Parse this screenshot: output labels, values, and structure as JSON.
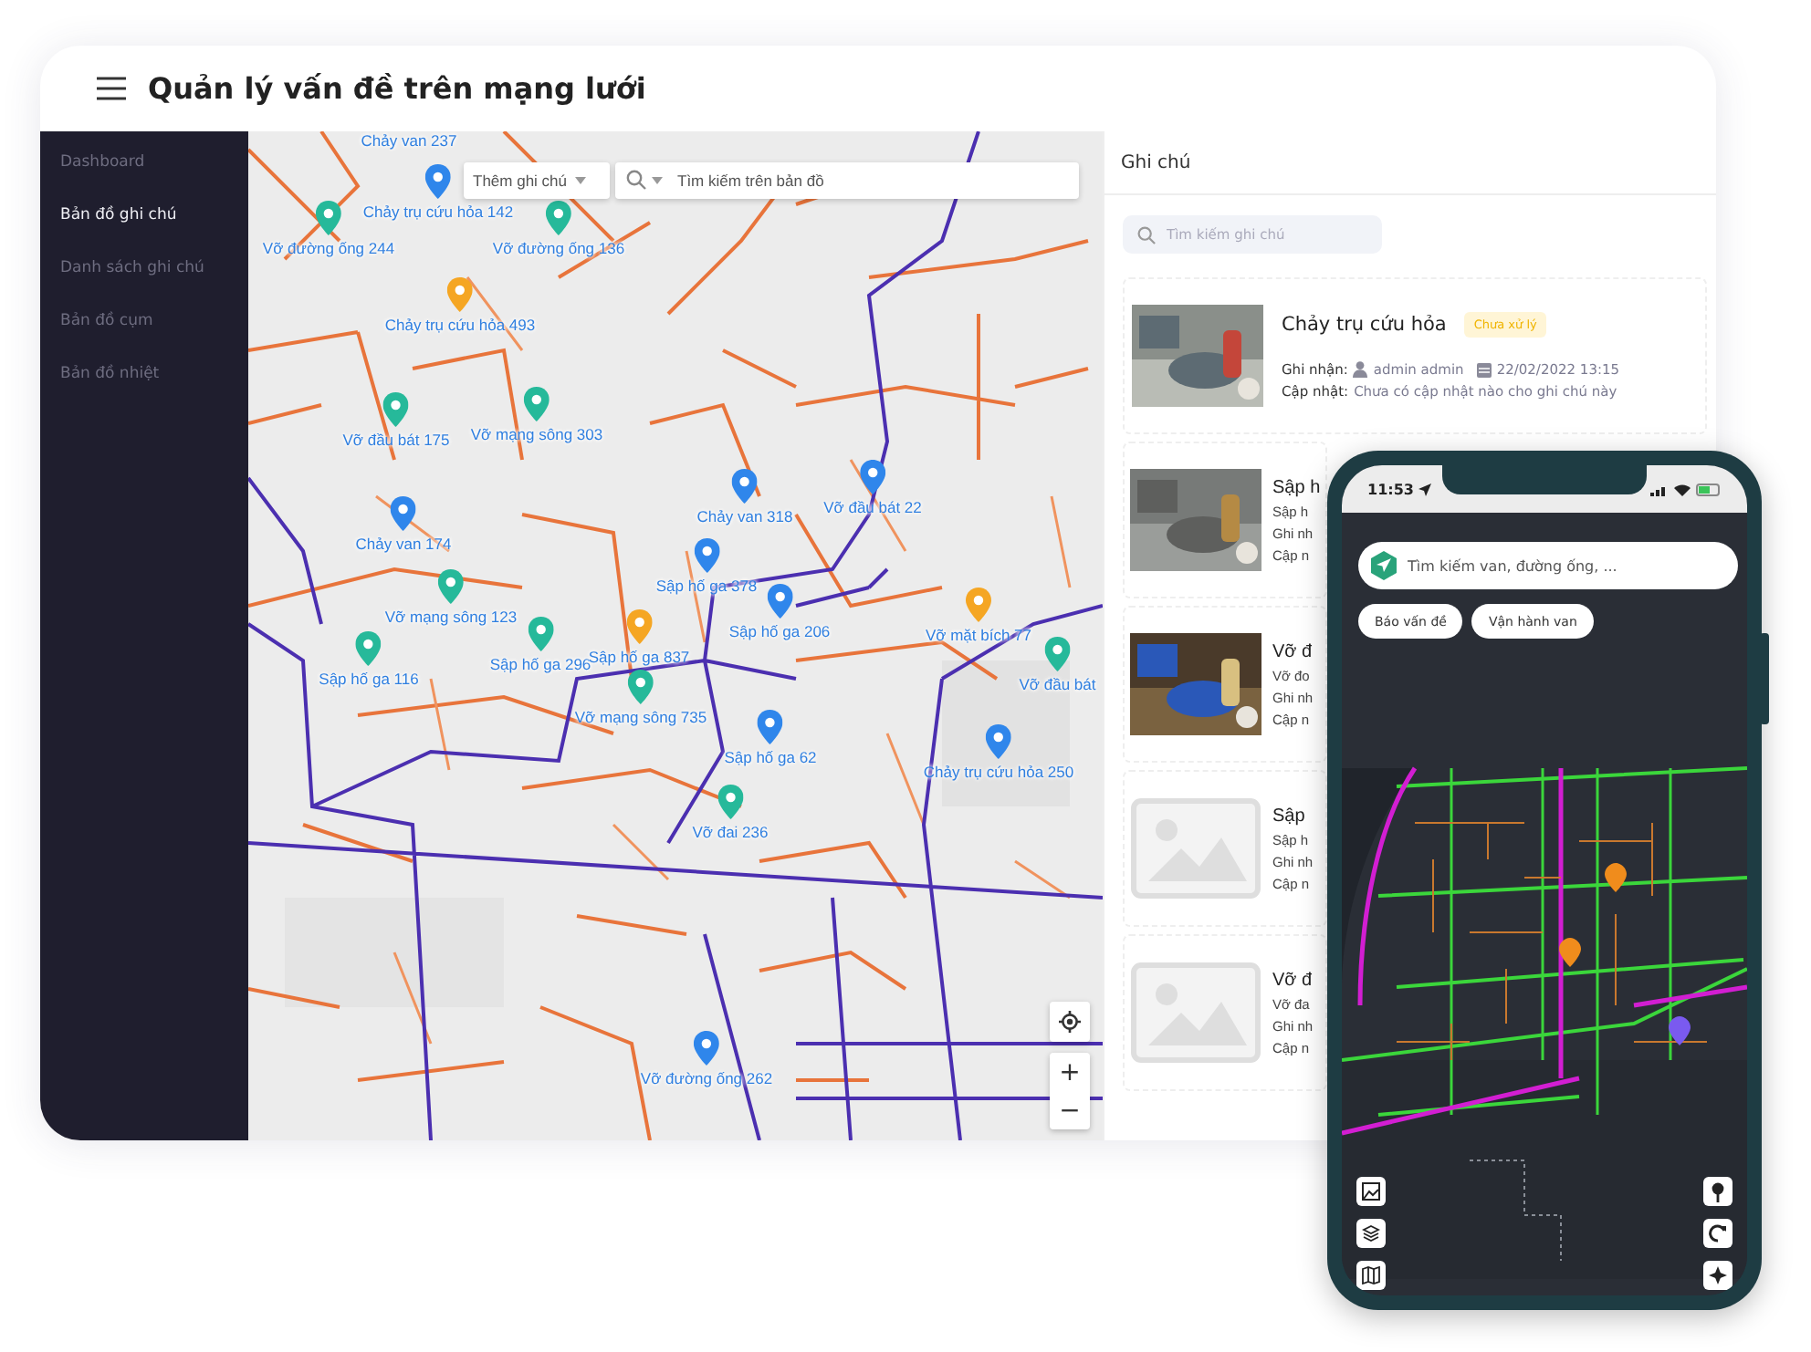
{
  "header": {
    "title": "Quản lý vấn đề trên mạng lưới"
  },
  "sidebar": {
    "items": [
      {
        "label": "Dashboard",
        "selected": false
      },
      {
        "label": "Bản đồ ghi chú",
        "selected": true
      },
      {
        "label": "Danh sách ghi chú",
        "selected": false
      },
      {
        "label": "Bản đồ cụm",
        "selected": false
      },
      {
        "label": "Bản đồ nhiệt",
        "selected": false
      }
    ]
  },
  "map": {
    "add_note": {
      "label": "Thêm ghi chú"
    },
    "search": {
      "placeholder": "Tìm kiếm trên bản đồ"
    },
    "zoom_in": "+",
    "zoom_out": "−",
    "markers": [
      {
        "label": "Chảy van 237"
      },
      {
        "label": "Chảy trụ cứu hỏa 142",
        "color": "#2f86eb"
      },
      {
        "label": "Vỡ đường ống 244",
        "color": "#26b99a"
      },
      {
        "label": "Vỡ đường ống 136",
        "color": "#26b99a"
      },
      {
        "label": "Chảy trụ cứu hỏa 493",
        "color": "#f5a623"
      },
      {
        "label": "Vỡ đầu bát 175",
        "color": "#26b99a"
      },
      {
        "label": "Vỡ mạng sông 303",
        "color": "#26b99a"
      },
      {
        "label": "Chảy van 174",
        "color": "#2f86eb"
      },
      {
        "label": "Chảy van 318",
        "color": "#2f86eb"
      },
      {
        "label": "Vỡ đầu bát 22",
        "color": "#2f86eb"
      },
      {
        "label": "Sập hố ga 378",
        "color": "#2f86eb"
      },
      {
        "label": "Vỡ mạng sông 123",
        "color": "#26b99a"
      },
      {
        "label": "Sập hố ga 206",
        "color": "#2f86eb"
      },
      {
        "label": "Vỡ mặt bích 77",
        "color": "#f5a623"
      },
      {
        "label": "Sập hố ga 296",
        "color": "#26b99a"
      },
      {
        "label": "Sập hố ga 837",
        "color": "#f5a623"
      },
      {
        "label": "Sập hố ga 116",
        "color": "#26b99a"
      },
      {
        "label": "Vỡ đầu bát",
        "color": "#26b99a"
      },
      {
        "label": "Vỡ mạng sông 735",
        "color": "#26b99a"
      },
      {
        "label": "Sập hố ga 62",
        "color": "#2f86eb"
      },
      {
        "label": "Chảy trụ cứu hỏa 250",
        "color": "#2f86eb"
      },
      {
        "label": "Vỡ đai 236",
        "color": "#26b99a"
      },
      {
        "label": "Vỡ đường ống 262",
        "color": "#2f86eb"
      }
    ]
  },
  "notes": {
    "title": "Ghi chú",
    "search": {
      "placeholder": "Tìm kiếm ghi chú"
    },
    "items": [
      {
        "kind": "full",
        "title": "Chảy trụ cứu hỏa",
        "status": "Chưa xử lý",
        "recorded_label": "Ghi nhận:",
        "recorded_by": "admin admin",
        "recorded_at": "22/02/2022 13:15",
        "updated_label": "Cập nhật:",
        "updated_text": "Chưa có cập nhật nào cho ghi chú này"
      },
      {
        "kind": "partial",
        "title": "Sập h",
        "lines": [
          "Sập h",
          "Ghi nh",
          "Cập n"
        ]
      },
      {
        "kind": "partial",
        "title": "Vỡ đ",
        "lines": [
          "Vỡ đo",
          "Ghi nh",
          "Cập n"
        ]
      },
      {
        "kind": "partial",
        "title": "Sập",
        "lines": [
          "Sập h",
          "Ghi nh",
          "Cập n"
        ]
      },
      {
        "kind": "partial",
        "title": "Vỡ đ",
        "lines": [
          "Vỡ đa",
          "Ghi nh",
          "Cập n"
        ]
      }
    ]
  },
  "phone": {
    "time": "11:53",
    "search": {
      "placeholder": "Tìm kiếm van, đường ống, ..."
    },
    "chips": [
      "Báo vấn đề",
      "Vận hành van"
    ]
  }
}
